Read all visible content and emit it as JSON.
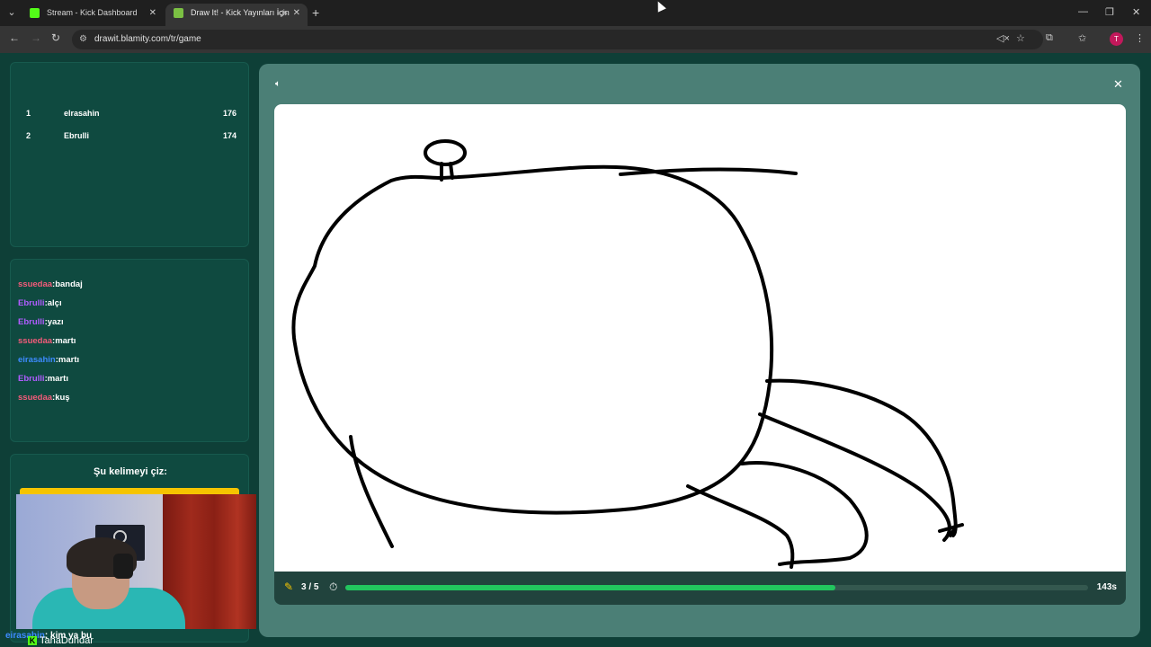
{
  "browser": {
    "tabs": [
      {
        "title": "Stream - Kick Dashboard",
        "favicon_color": "#53fc18"
      },
      {
        "title": "Draw It! - Kick Yayınları İçin",
        "favicon_color": "#7bc043"
      }
    ],
    "url": "drawit.blamity.com/tr/game",
    "profile_initial": "T"
  },
  "leaderboard": [
    {
      "rank": "1",
      "name": "elrasahin",
      "score": "176"
    },
    {
      "rank": "2",
      "name": "Ebrulli",
      "score": "174"
    }
  ],
  "chat": [
    {
      "user": "ssuedaa",
      "message": "bandaj",
      "color": "#f45b7a"
    },
    {
      "user": "Ebrulli",
      "message": "alçı",
      "color": "#b05cff"
    },
    {
      "user": "Ebrulli",
      "message": "yazı",
      "color": "#b05cff"
    },
    {
      "user": "ssuedaa",
      "message": "martı",
      "color": "#f45b7a"
    },
    {
      "user": "eirasahin",
      "message": "martı",
      "color": "#3d8bff"
    },
    {
      "user": "Ebrulli",
      "message": "martı",
      "color": "#b05cff"
    },
    {
      "user": "ssuedaa",
      "message": "kuş",
      "color": "#f45b7a"
    }
  ],
  "word_panel": {
    "title": "Şu kelimeyi çiz:"
  },
  "webcam": {
    "caption_user": "eirasahin",
    "caption_message": ": kim ya bu",
    "channel_name": "TahaDundar"
  },
  "game": {
    "round": "3 / 5",
    "time_left": "143s",
    "progress_fraction": 0.66
  }
}
